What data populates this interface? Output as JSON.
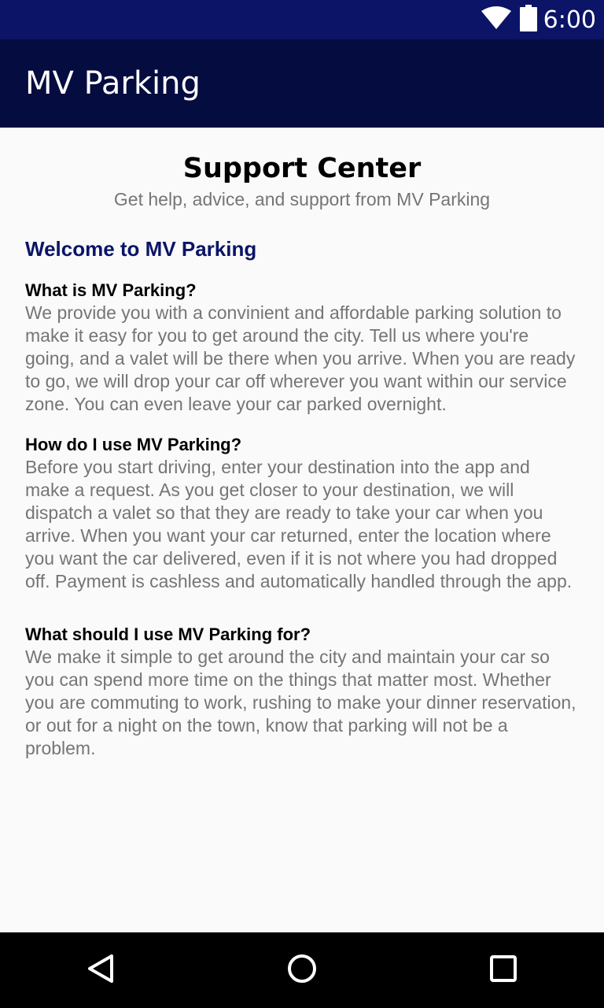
{
  "status_bar": {
    "time": "6:00",
    "icons": [
      "wifi-icon",
      "battery-icon"
    ]
  },
  "app_bar": {
    "title": "MV Parking"
  },
  "page": {
    "title": "Support Center",
    "subtitle": "Get help, advice, and support from  MV Parking",
    "section_title": "Welcome to MV Parking"
  },
  "faqs": [
    {
      "question": "What is MV Parking?",
      "answer": "We provide you with a convinient and affordable parking solution to make it easy for you to get around the city. Tell us where you're going, and a valet will be there when you arrive. When you are ready to go, we will drop your car off wherever you want within our service zone. You can even leave your car parked overnight."
    },
    {
      "question": "How do I use MV Parking?",
      "answer": "Before you start driving, enter your destination into the app and make a request. As you get closer to your destination, we will dispatch a valet so that they are ready to take your car when you arrive. When you want your car returned, enter the location where you want the car delivered, even if it is not where you had dropped off. Payment is cashless and automatically handled through the app."
    },
    {
      "question": "What should I use MV Parking for?",
      "answer": "We make it simple to get around the city and maintain your car so you can spend more time on the things that matter most. Whether you are commuting to work, rushing to make your dinner reservation, or out for a night on the town, know that parking will not be a problem."
    }
  ],
  "nav_bar": {
    "icons": [
      "back-icon",
      "home-icon",
      "recents-icon"
    ]
  },
  "colors": {
    "status_bar": "#0b1466",
    "app_bar": "#050c3f",
    "accent": "#0b1466",
    "body_text": "#757575"
  }
}
